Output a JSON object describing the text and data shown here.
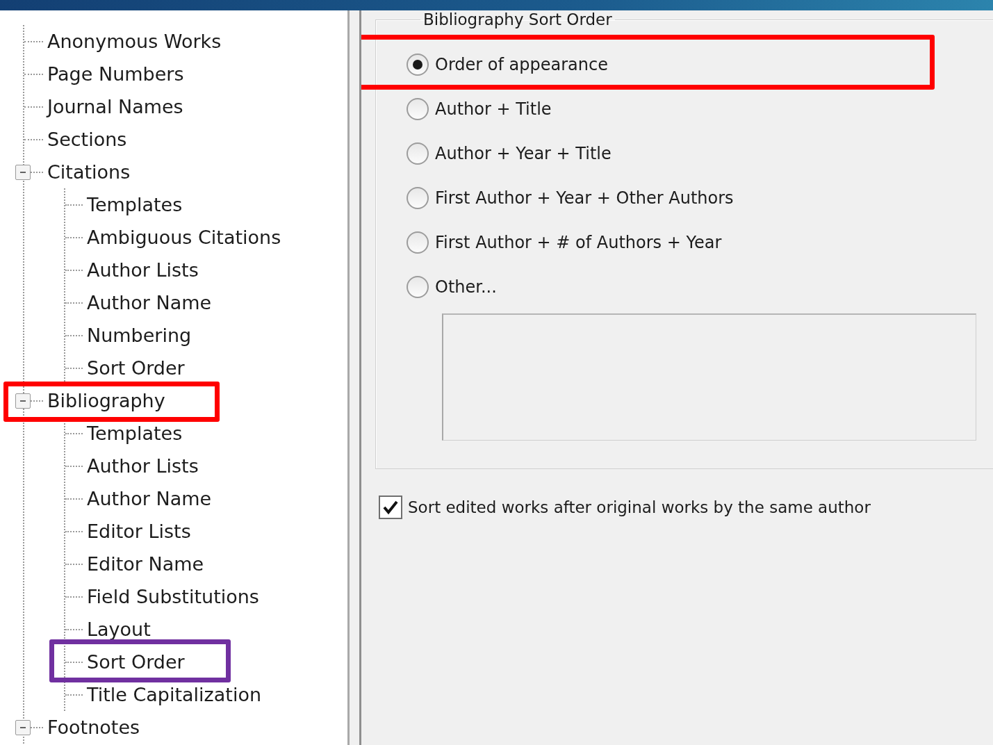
{
  "tree": [
    {
      "label": "Anonymous Works"
    },
    {
      "label": "Page Numbers"
    },
    {
      "label": "Journal Names"
    },
    {
      "label": "Sections"
    },
    {
      "label": "Citations",
      "expanded": true,
      "children": [
        {
          "label": "Templates"
        },
        {
          "label": "Ambiguous Citations"
        },
        {
          "label": "Author Lists"
        },
        {
          "label": "Author Name"
        },
        {
          "label": "Numbering"
        },
        {
          "label": "Sort Order"
        }
      ]
    },
    {
      "label": "Bibliography",
      "expanded": true,
      "color": "#ff0000",
      "children": [
        {
          "label": "Templates"
        },
        {
          "label": "Author Lists"
        },
        {
          "label": "Author Name"
        },
        {
          "label": "Editor Lists"
        },
        {
          "label": "Editor Name"
        },
        {
          "label": "Field Substitutions"
        },
        {
          "label": "Layout"
        },
        {
          "label": "Sort Order",
          "color": "#7030a0"
        },
        {
          "label": "Title Capitalization"
        }
      ]
    },
    {
      "label": "Footnotes",
      "expanded": true
    }
  ],
  "sort_group": {
    "title": "Bibliography Sort Order",
    "options": [
      {
        "label": "Order of appearance",
        "selected": true,
        "color": "#ff0000"
      },
      {
        "label": "Author + Title",
        "selected": false
      },
      {
        "label": "Author + Year + Title",
        "selected": false
      },
      {
        "label": "First Author + Year + Other Authors",
        "selected": false
      },
      {
        "label": "First Author + # of Authors + Year",
        "selected": false
      },
      {
        "label": "Other...",
        "selected": false
      }
    ]
  },
  "edited_works_checkbox": {
    "label": "Sort edited works after original works by the same author",
    "checked": true
  }
}
